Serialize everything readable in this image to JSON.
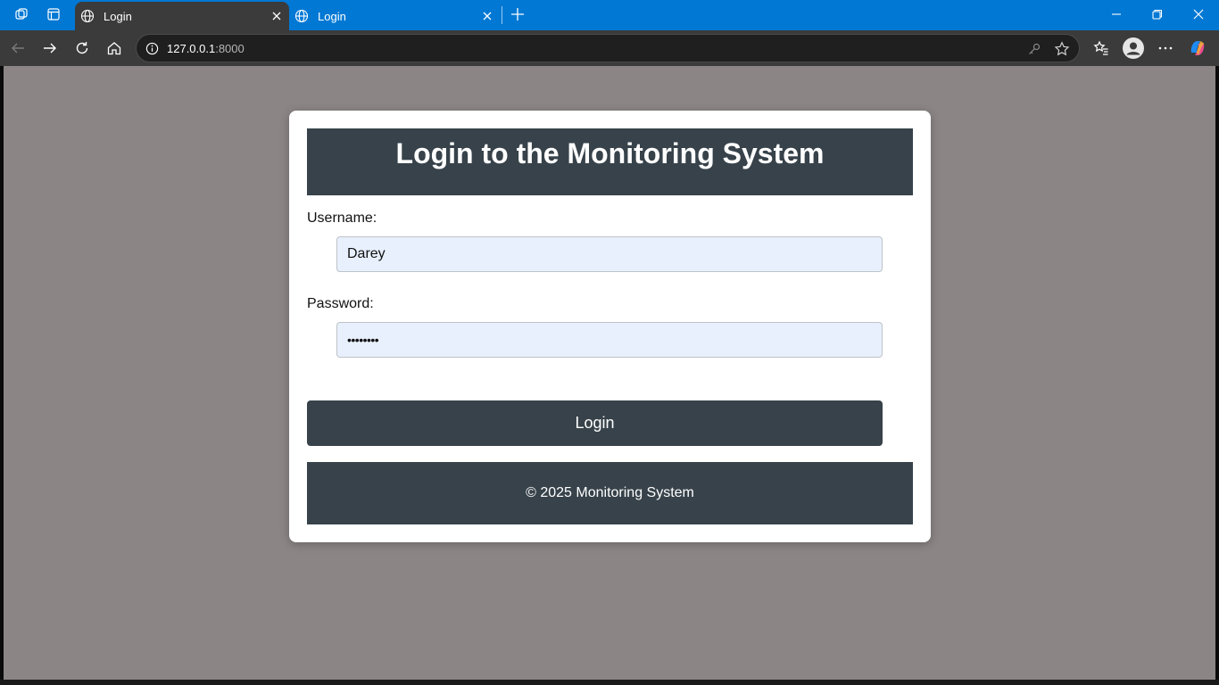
{
  "browser": {
    "tabs": [
      {
        "title": "Login",
        "active": true
      },
      {
        "title": "Login",
        "active": false
      }
    ],
    "address": {
      "host": "127.0.0.1",
      "port": ":8000"
    },
    "icons": {
      "workspaces": "workspaces-icon",
      "tab_actions": "tab-actions-icon",
      "globe": "globe-icon",
      "close": "close-icon",
      "new_tab": "plus-icon",
      "minimize": "minimize-icon",
      "restore": "restore-icon",
      "back": "back-arrow-icon",
      "forward": "forward-arrow-icon",
      "refresh": "refresh-icon",
      "home": "home-icon",
      "info": "info-icon",
      "key": "key-icon",
      "favorite": "star-icon",
      "favorites": "favorites-icon",
      "profile": "profile-icon",
      "more": "more-icon",
      "copilot": "copilot-icon"
    },
    "colors": {
      "tabstrip": "#0078d4",
      "toolbar": "#3b3b3b",
      "omnibox": "#1f1f1f"
    }
  },
  "page": {
    "title": "Login to the Monitoring System",
    "username": {
      "label": "Username:",
      "value": "Darey"
    },
    "password": {
      "label": "Password:",
      "value": "••••••••"
    },
    "login_button": "Login",
    "footer": "© 2025 Monitoring System",
    "colors": {
      "background": "#8b8585",
      "panel": "#37424a",
      "input_fill": "#e8f0fe"
    }
  }
}
